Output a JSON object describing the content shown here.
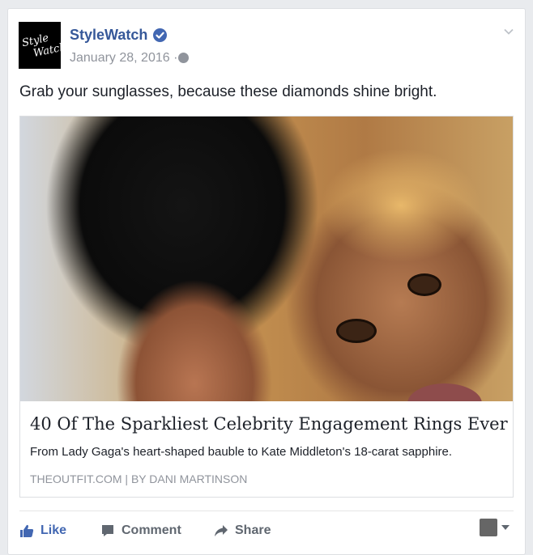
{
  "post": {
    "page_name": "StyleWatch",
    "avatar_text_1": "Style",
    "avatar_text_2": "Watch",
    "date": "January 28, 2016 ·",
    "message": "Grab your sunglasses, because these diamonds shine bright."
  },
  "link": {
    "title": "40 Of The Sparkliest Celebrity Engagement Rings Ever",
    "description": "From Lady Gaga's heart-shaped bauble to Kate Middleton's 18-carat sapphire.",
    "source": "THEOUTFIT.COM  |  BY DANI MARTINSON"
  },
  "actions": {
    "like": "Like",
    "comment": "Comment",
    "share": "Share"
  },
  "colors": {
    "brand_blue": "#4267b2",
    "name_blue": "#365899",
    "muted": "#90949c"
  }
}
